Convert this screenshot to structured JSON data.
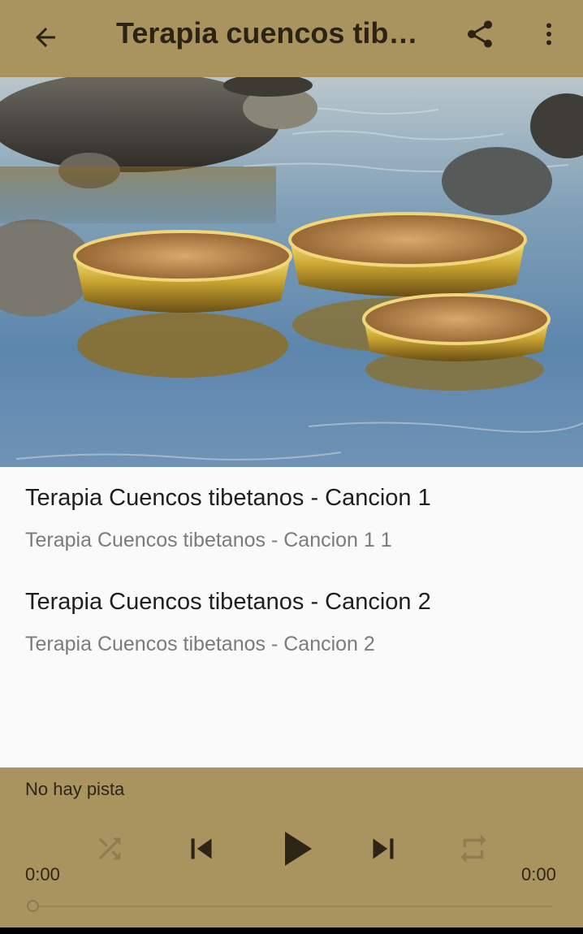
{
  "app_bar": {
    "title": "Terapia cuencos tibetanos",
    "back_icon": "arrow-left-icon",
    "share_icon": "share-icon",
    "more_icon": "more-vertical-icon",
    "background": "#a99460"
  },
  "tracks": [
    {
      "title": "Terapia Cuencos tibetanos - Cancion 1",
      "subtitle": "Terapia Cuencos tibetanos - Cancion 1 1"
    },
    {
      "title": "Terapia Cuencos tibetanos - Cancion 2",
      "subtitle": "Terapia Cuencos tibetanos - Cancion 2"
    }
  ],
  "player": {
    "track_label": "No hay pista",
    "elapsed": "0:00",
    "duration": "0:00",
    "progress": 0,
    "controls": [
      "shuffle-icon",
      "previous-icon",
      "play-icon",
      "next-icon",
      "repeat-icon"
    ]
  }
}
